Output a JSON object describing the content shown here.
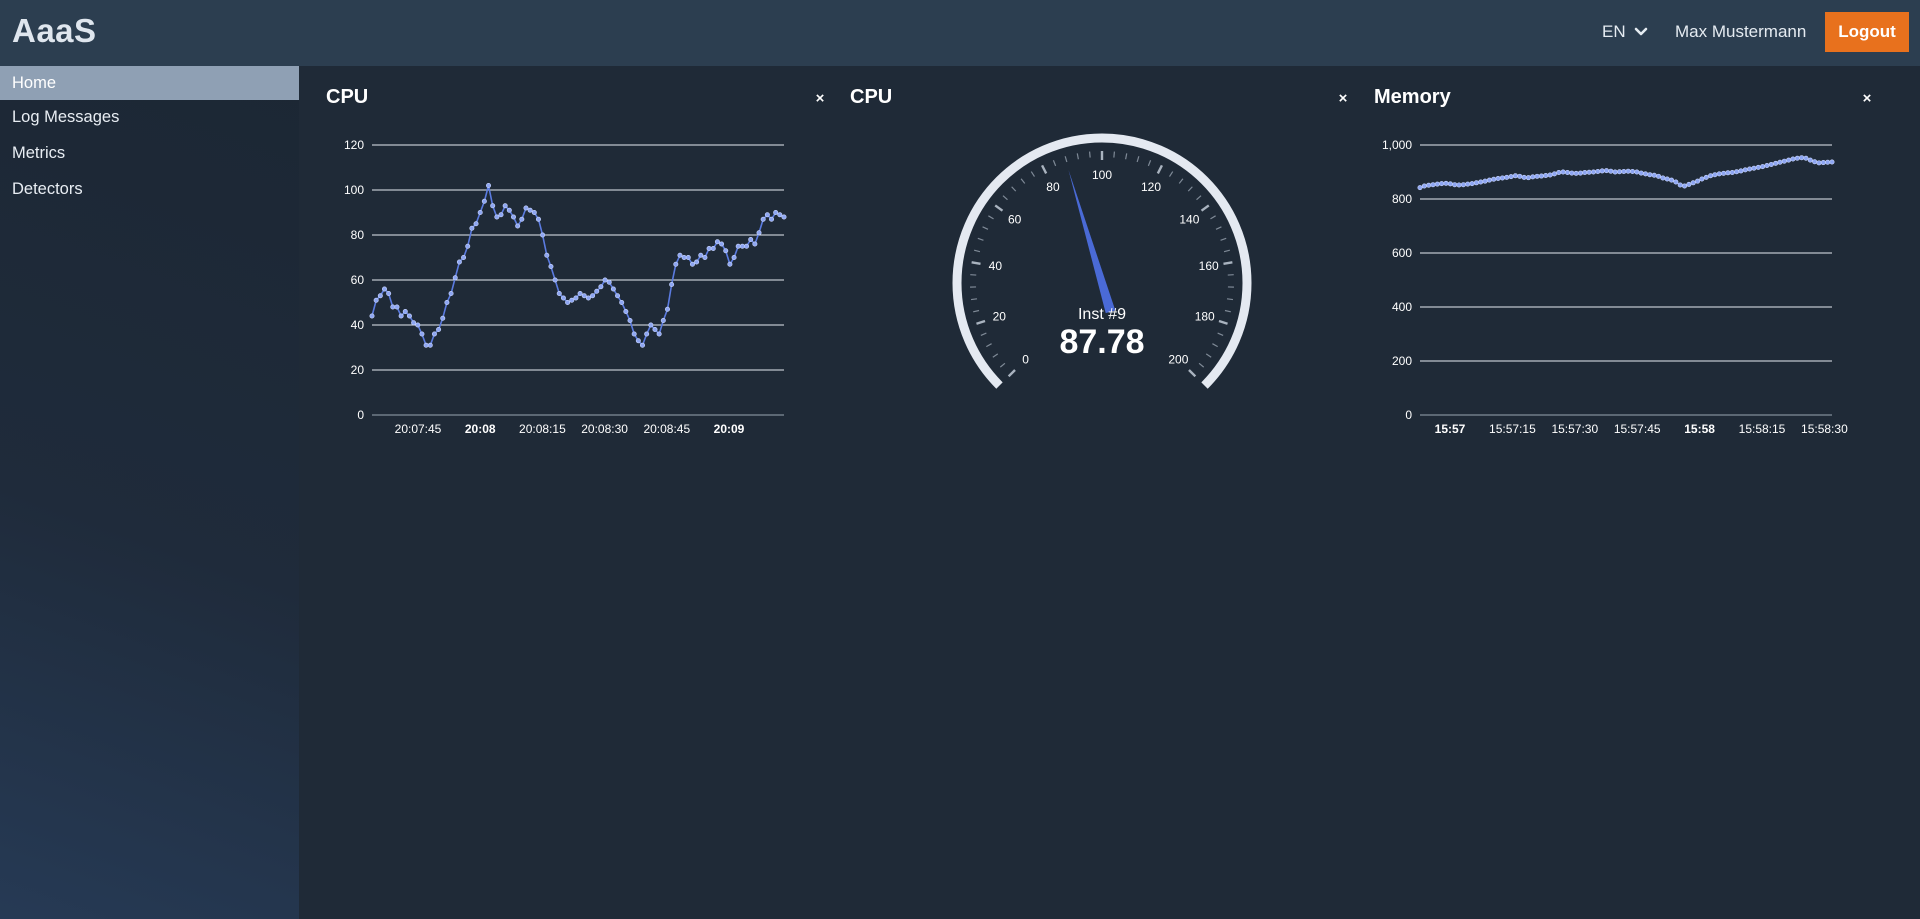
{
  "app": {
    "title": "AaaS"
  },
  "header": {
    "language": "EN",
    "user": "Max Mustermann",
    "logout_label": "Logout"
  },
  "sidebar": {
    "items": [
      {
        "label": "Home",
        "active": true
      },
      {
        "label": "Log Messages",
        "active": false
      },
      {
        "label": "Metrics",
        "active": false
      },
      {
        "label": "Detectors",
        "active": false
      }
    ]
  },
  "widgets": {
    "cpu_line": {
      "title": "CPU",
      "close": "×"
    },
    "cpu_gauge": {
      "title": "CPU",
      "close": "×"
    },
    "memory": {
      "title": "Memory",
      "close": "×"
    }
  },
  "colors": {
    "accent": "#e8711d",
    "series": "#5b7be0",
    "gauge_needle": "#4a6ad6"
  },
  "chart_data": [
    {
      "type": "line",
      "ylim": [
        0,
        120
      ],
      "y_ticks": [
        "0",
        "20",
        "40",
        "60",
        "80",
        "100",
        "120"
      ],
      "x_ticks": [
        {
          "label": "20:07:45",
          "bold": false
        },
        {
          "label": "20:08",
          "bold": true
        },
        {
          "label": "20:08:15",
          "bold": false
        },
        {
          "label": "20:08:30",
          "bold": false
        },
        {
          "label": "20:08:45",
          "bold": false
        },
        {
          "label": "20:09",
          "bold": true
        }
      ],
      "series": [
        {
          "values": [
            44,
            51,
            53,
            56,
            54,
            48,
            48,
            44,
            46,
            44,
            41,
            40,
            36,
            31,
            31,
            36,
            38,
            43,
            50,
            54,
            61,
            68,
            70,
            75,
            83,
            85,
            90,
            95,
            102,
            93,
            88,
            89,
            93,
            91,
            88,
            84,
            87,
            92,
            91,
            90,
            87,
            80,
            71,
            66,
            60,
            54,
            52,
            50,
            51,
            52,
            54,
            53,
            52,
            53,
            55,
            57,
            60,
            59,
            56,
            53,
            50,
            46,
            42,
            36,
            33,
            31,
            36,
            40,
            38,
            36,
            42,
            47,
            58,
            67,
            71,
            70,
            70,
            67,
            68,
            71,
            70,
            74,
            74,
            77,
            76,
            73,
            67,
            70,
            75,
            75,
            75,
            78,
            76,
            81,
            87,
            89,
            87,
            90,
            89,
            88
          ]
        }
      ]
    },
    {
      "type": "gauge",
      "min": 0,
      "max": 200,
      "tick_labels": [
        "0",
        "20",
        "40",
        "60",
        "80",
        "100",
        "120",
        "140",
        "160",
        "180",
        "200"
      ],
      "label": "Inst #9",
      "value": 87.78
    },
    {
      "type": "line",
      "ylim": [
        0,
        1000
      ],
      "y_ticks": [
        "0",
        "200",
        "400",
        "600",
        "800",
        "1,000"
      ],
      "x_ticks": [
        {
          "label": "15:57",
          "bold": true
        },
        {
          "label": "15:57:15",
          "bold": false
        },
        {
          "label": "15:57:30",
          "bold": false
        },
        {
          "label": "15:57:45",
          "bold": false
        },
        {
          "label": "15:58",
          "bold": true
        },
        {
          "label": "15:58:15",
          "bold": false
        },
        {
          "label": "15:58:30",
          "bold": false
        }
      ],
      "series": [
        {
          "values": [
            842,
            848,
            851,
            853,
            855,
            857,
            858,
            856,
            853,
            852,
            853,
            855,
            857,
            860,
            863,
            866,
            870,
            873,
            876,
            878,
            880,
            883,
            886,
            884,
            880,
            879,
            882,
            884,
            885,
            887,
            889,
            893,
            898,
            900,
            898,
            896,
            895,
            896,
            898,
            899,
            900,
            902,
            904,
            905,
            903,
            900,
            901,
            902,
            903,
            902,
            900,
            896,
            893,
            890,
            888,
            884,
            878,
            874,
            870,
            863,
            852,
            848,
            854,
            860,
            866,
            874,
            880,
            886,
            890,
            893,
            895,
            897,
            898,
            901,
            904,
            908,
            911,
            914,
            917,
            920,
            924,
            928,
            932,
            936,
            940,
            944,
            948,
            951,
            953,
            951,
            944,
            938,
            934,
            935,
            936,
            937
          ]
        }
      ]
    }
  ]
}
